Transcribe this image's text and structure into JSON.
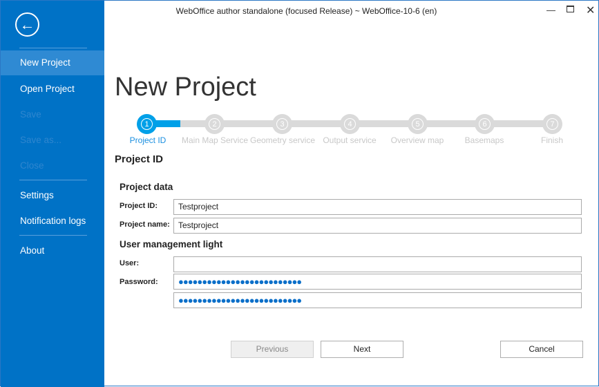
{
  "window": {
    "title": "WebOffice author standalone (focused Release) ~ WebOffice-10-6 (en)"
  },
  "sidebar": {
    "back": "←",
    "items": [
      {
        "label": "New Project",
        "state": "selected"
      },
      {
        "label": "Open Project",
        "state": "enabled"
      },
      {
        "label": "Save",
        "state": "disabled"
      },
      {
        "label": "Save as...",
        "state": "disabled"
      },
      {
        "label": "Close",
        "state": "disabled"
      },
      {
        "label": "Settings",
        "state": "enabled"
      },
      {
        "label": "Notification logs",
        "state": "enabled"
      },
      {
        "label": "About",
        "state": "enabled"
      }
    ]
  },
  "page": {
    "title": "New Project",
    "section": "Project ID"
  },
  "steps": [
    {
      "n": "1",
      "label": "Project ID"
    },
    {
      "n": "2",
      "label": "Main Map Service"
    },
    {
      "n": "3",
      "label": "Geometry service"
    },
    {
      "n": "4",
      "label": "Output service"
    },
    {
      "n": "5",
      "label": "Overview map"
    },
    {
      "n": "6",
      "label": "Basemaps"
    },
    {
      "n": "7",
      "label": "Finish"
    }
  ],
  "form": {
    "project_data": "Project data",
    "project_id_label": "Project ID:",
    "project_id": "Testproject",
    "project_name_label": "Project name:",
    "project_name": "Testproject",
    "user_mgmt": "User management light",
    "user_label": "User:",
    "user": "",
    "password_label": "Password:",
    "password": "●●●●●●●●●●●●●●●●●●●●●●●●●●",
    "password_confirm": "●●●●●●●●●●●●●●●●●●●●●●●●●●"
  },
  "buttons": {
    "previous": "Previous",
    "next": "Next",
    "cancel": "Cancel"
  }
}
